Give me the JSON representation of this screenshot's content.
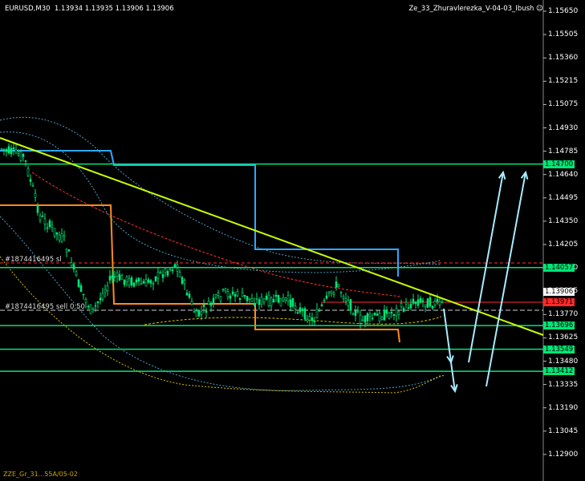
{
  "header": {
    "symbol": "EURUSD,M30",
    "ohlc": "1.13934 1.13935 1.13906 1.13906",
    "indicator": "Ze_33_Zhuravlerezka_V-04-03_Ibush"
  },
  "axis": {
    "ticks": [
      "1.15650",
      "1.15505",
      "1.15360",
      "1.15215",
      "1.15075",
      "1.14930",
      "1.14785",
      "1.14640",
      "1.14495",
      "1.14350",
      "1.14205",
      "1.14060",
      "1.13915",
      "1.13770",
      "1.13625",
      "1.13480",
      "1.13335",
      "1.13190",
      "1.13045",
      "1.12900"
    ]
  },
  "levels": [
    {
      "label": "1.14700",
      "type": "green"
    },
    {
      "label": "1.14057",
      "type": "green"
    },
    {
      "label": "1.13696",
      "type": "green"
    },
    {
      "label": "1.13549",
      "type": "green"
    },
    {
      "label": "1.13412",
      "type": "green"
    }
  ],
  "current_price": "1.13906",
  "order_tags": {
    "sl_price": "1.13971",
    "sl_label": "#1874416495 sl",
    "sell_label": "#1874416495 sell 0.50"
  },
  "footer": "ZZE_Gr_31...55A/05-02",
  "colors": {
    "level": "#00e676",
    "candle": "#00e676",
    "trendline": "#c8ff00",
    "blue_step": "#2fa8ff",
    "orange_step": "#ff8c1a",
    "arrow": "#a8ecff",
    "order_red": "#ff3030"
  }
}
